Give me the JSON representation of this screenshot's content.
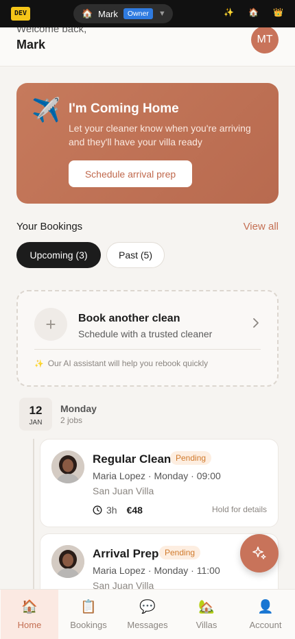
{
  "devbar": {
    "env_badge": "DEV",
    "user_name": "Mark",
    "role_badge": "Owner",
    "icons": [
      "sparkles-icon",
      "house-icon",
      "crown-icon"
    ]
  },
  "header": {
    "welcome": "Welcome back,",
    "name": "Mark",
    "avatar_initials": "MT"
  },
  "hero": {
    "title": "I'm Coming Home",
    "description": "Let your cleaner know when you're arriving and they'll have your villa ready",
    "cta": "Schedule arrival prep"
  },
  "bookings": {
    "title": "Your Bookings",
    "view_all": "View all",
    "tabs": [
      {
        "label": "Upcoming (3)",
        "active": true
      },
      {
        "label": "Past (5)",
        "active": false
      }
    ]
  },
  "book_another": {
    "title": "Book another clean",
    "subtitle": "Schedule with a trusted cleaner",
    "ai_note": "Our AI assistant will help you rebook quickly"
  },
  "date_group": {
    "day": "12",
    "month": "JAN",
    "weekday": "Monday",
    "jobs": "2 jobs"
  },
  "jobs": [
    {
      "title": "Regular Clean",
      "status": "Pending",
      "details": "Maria Lopez · Monday · 09:00",
      "villa": "San Juan Villa",
      "duration": "3h",
      "price": "€48",
      "hint": "Hold for details"
    },
    {
      "title": "Arrival Prep",
      "status": "Pending",
      "details": "Maria Lopez · Monday · 11:00",
      "villa": "San Juan Villa"
    }
  ],
  "nav": [
    {
      "label": "Home",
      "icon": "house-icon",
      "active": true
    },
    {
      "label": "Bookings",
      "icon": "clipboard-icon",
      "active": false
    },
    {
      "label": "Messages",
      "icon": "speech-bubble-icon",
      "active": false
    },
    {
      "label": "Villas",
      "icon": "villa-icon",
      "active": false
    },
    {
      "label": "Account",
      "icon": "person-icon",
      "active": false
    }
  ],
  "colors": {
    "accent": "#c8735a",
    "accent_text": "#c46f53",
    "pending_bg": "#fdeee1",
    "pending_text": "#d07a2c"
  }
}
